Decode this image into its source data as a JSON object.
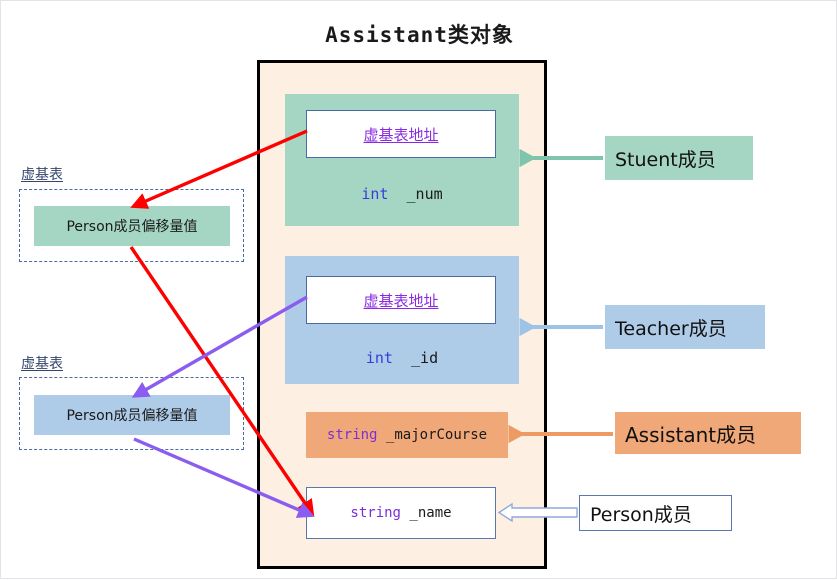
{
  "title": "Assistant类对象",
  "object_box": {
    "name": "assistant-object-layout",
    "student_block": {
      "vptr_label": "虚基表地址",
      "field": "int  _num",
      "field_keyword": "int",
      "field_name": "_num",
      "color": "#a5d6c4"
    },
    "teacher_block": {
      "vptr_label": "虚基表地址",
      "field": "int  _id",
      "field_keyword": "int",
      "field_name": "_id",
      "color": "#aecbe8"
    },
    "assistant_field": {
      "keyword": "string",
      "name": "_majorCourse",
      "color": "#f0a879"
    },
    "person_field": {
      "keyword": "string",
      "name": "_name",
      "color": "#ffffff"
    }
  },
  "vbtables": [
    {
      "label": "虚基表",
      "entry": "Person成员偏移量值",
      "color": "#a5d6c4"
    },
    {
      "label": "虚基表",
      "entry": "Person成员偏移量值",
      "color": "#aecbe8"
    }
  ],
  "legend": [
    {
      "label": "Stuent成员",
      "color": "#a5d6c4",
      "arrow_color": "#7fc4ad"
    },
    {
      "label": "Teacher成员",
      "color": "#aecbe8",
      "arrow_color": "#9dc3e6"
    },
    {
      "label": "Assistant成员",
      "color": "#f0a879",
      "arrow_color": "#ed9b63"
    },
    {
      "label": "Person成员",
      "color": "#ffffff",
      "arrow_color": "#8faadc"
    }
  ],
  "arrows": {
    "student_vptr_to_vbt": "#ff0000",
    "vbt1_to_name": "#ff0000",
    "teacher_vptr_to_vbt": "#8a5cf0",
    "vbt2_to_name": "#8a5cf0"
  },
  "colors": {
    "container_border": "#000000",
    "container_fill": "#fdefe1",
    "vptr_text": "#8a2be2",
    "keyword_blue": "#3b3bdb",
    "keyword_purple": "#7b2fd4",
    "vbt_label": "#33456b",
    "dash_border": "#4a6aa5"
  }
}
